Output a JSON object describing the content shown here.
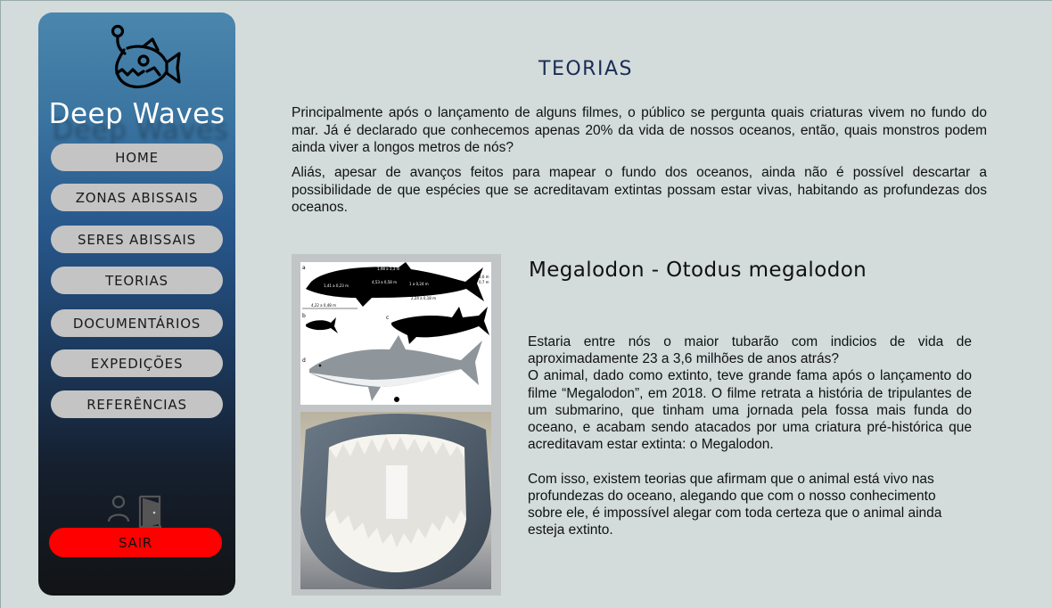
{
  "brand": {
    "name": "Deep Waves",
    "logo_icon": "anglerfish-icon"
  },
  "nav": [
    {
      "label": "HOME"
    },
    {
      "label": "ZONAS ABISSAIS"
    },
    {
      "label": "SERES ABISSAIS"
    },
    {
      "label": "TEORIAS"
    },
    {
      "label": "DOCUMENTÁRIOS"
    },
    {
      "label": "EXPEDIÇÕES"
    },
    {
      "label": "REFERÊNCIAS"
    }
  ],
  "user_icons": [
    "user-icon",
    "door-exit-icon"
  ],
  "logout": {
    "label": "SAIR",
    "color": "#ff0000"
  },
  "page": {
    "title": "TEORIAS",
    "intro": [
      "Principalmente após o lançamento de alguns filmes, o público se pergunta quais criaturas vivem no fundo do mar. Já é declarado que conhecemos apenas 20% da vida de nossos oceanos, então, quais monstros podem ainda viver a longos metros de nós?",
      "Aliás, apesar de avanços feitos para mapear o fundo dos oceanos,  ainda não é possível descartar a possibilidade de que espécies que se acreditavam extintas possam estar vivas, habitando as profundezas dos oceanos."
    ]
  },
  "section": {
    "title": "Megalodon - Otodus megalodon",
    "para1": "Estaria entre nós o maior tubarão com indicios de vida de aproximadamente 23 a 3,6 milhões de anos atrás?",
    "para2": "O animal, dado como extinto, teve grande fama após o lançamento do filme “Megalodon”, em 2018. O filme retrata a história de tripulantes de um submarino, que tinham uma jornada pela fossa mais funda do oceano, e acabam sendo atacados por uma criatura pré-histórica que acreditavam estar extinta: o Megalodon.",
    "para3": "Com isso, existem teorias que afirmam que o animal está vivo nas profundezas do oceano, alegando que com o nosso conhecimento sobre ele, é impossível alegar com toda certeza que o animal ainda esteja extinto.",
    "images": {
      "diagram": {
        "panel_labels": [
          "a",
          "b",
          "c",
          "d"
        ],
        "measurements": [
          "1,98 a 3,3 m",
          "1,41 a 0,23 m",
          "4,53 a 0,58 m",
          "1 a 0,24 m",
          "3,6 m",
          "0,7 m",
          "4,22 a 0,48 m",
          "3,05 a 0,77 m",
          "2,24 a 0,18 m"
        ]
      },
      "jaws_photo": "megalodon-jaws-photo"
    }
  }
}
